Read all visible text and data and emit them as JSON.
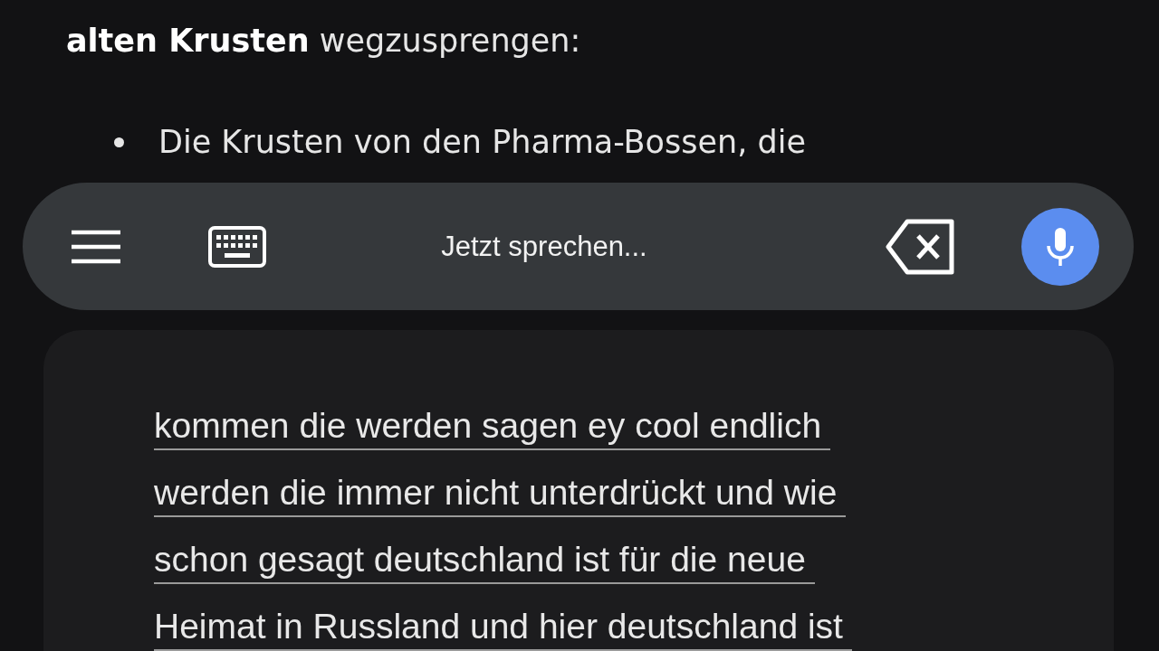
{
  "message": {
    "intro": "**alten Krusten** wegzusprengen:",
    "bullets": [
      "Die Krusten von den Pharma-Bossen, die"
    ]
  },
  "voice_bar": {
    "status": "Jetzt sprechen...",
    "mic_active": true
  },
  "transcript": {
    "lines": [
      "kommen die werden sagen ey cool endlich",
      "werden die immer nicht unterdrückt und wie",
      "schon gesagt deutschland ist für die neue",
      "Heimat in Russland und hier deutschland ist"
    ]
  }
}
